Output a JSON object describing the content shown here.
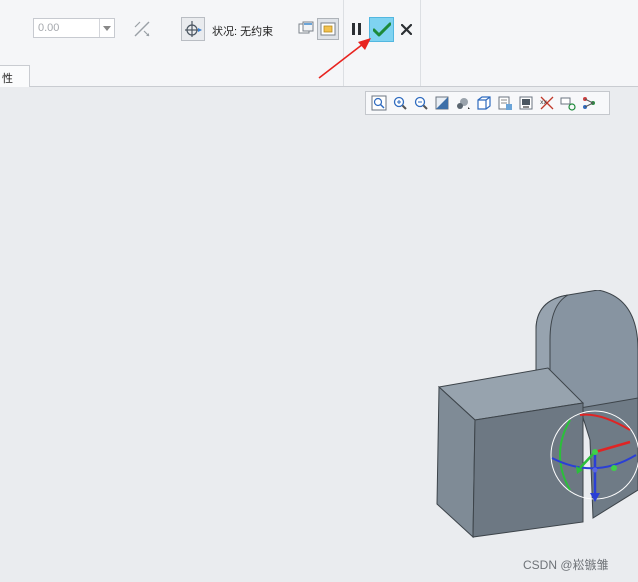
{
  "ribbon": {
    "value_combo": "0.00",
    "status_label": "状况: 无约束",
    "tab_label": "性"
  },
  "icons": {
    "combo_dropdown": "chevron-down-icon",
    "flip": "flip-direction-icon",
    "drag_move": "move-component-icon",
    "show_window_1": "window-icon",
    "show_window_2": "window-highlight-icon",
    "pause": "pause-icon",
    "confirm": "checkmark-icon",
    "cancel": "close-icon"
  },
  "view_toolbar": [
    "zoom-fit-icon",
    "zoom-in-icon",
    "zoom-out-icon",
    "repaint-icon",
    "perspective-icon",
    "display-style-icon",
    "saved-views-icon",
    "view-manager-icon",
    "datum-display-icon",
    "spin-center-icon",
    "annotation-icon"
  ],
  "watermark": "CSDN @崧镞雏",
  "colors": {
    "accent_confirm": "#5ac8ec",
    "annotation_arrow": "#e8231f",
    "model_face_light": "#8a96a2",
    "model_face_dark": "#6c7782"
  }
}
